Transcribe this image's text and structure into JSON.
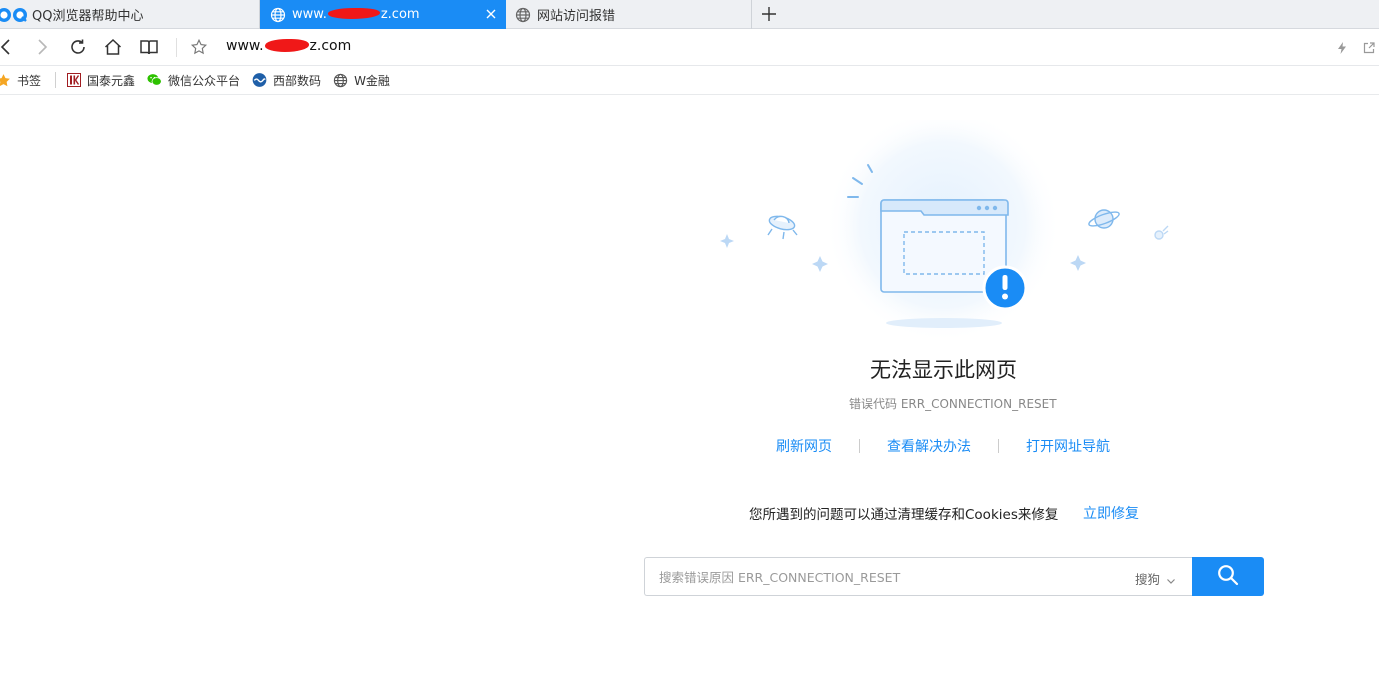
{
  "tabs": [
    {
      "title": "QQ浏览器帮助中心"
    },
    {
      "title_prefix": "www.",
      "title_suffix": "z.com"
    },
    {
      "title": "网站访问报错"
    }
  ],
  "toolbar": {
    "url_prefix": "www.",
    "url_suffix": "z.com"
  },
  "bookmarks": [
    {
      "label": "书签"
    },
    {
      "label": "国泰元鑫"
    },
    {
      "label": "微信公众平台"
    },
    {
      "label": "西部数码"
    },
    {
      "label": "W金融"
    }
  ],
  "error": {
    "title": "无法显示此网页",
    "code": "错误代码 ERR_CONNECTION_RESET",
    "actions": [
      "刷新网页",
      "查看解决办法",
      "打开网址导航"
    ],
    "fix_text": "您所遇到的问题可以通过清理缓存和Cookies来修复",
    "fix_link": "立即修复"
  },
  "search": {
    "placeholder": "搜索错误原因 ERR_CONNECTION_RESET",
    "engine": "搜狗"
  },
  "colors": {
    "accent": "#1a8cf5",
    "redaction": "#f01818"
  }
}
